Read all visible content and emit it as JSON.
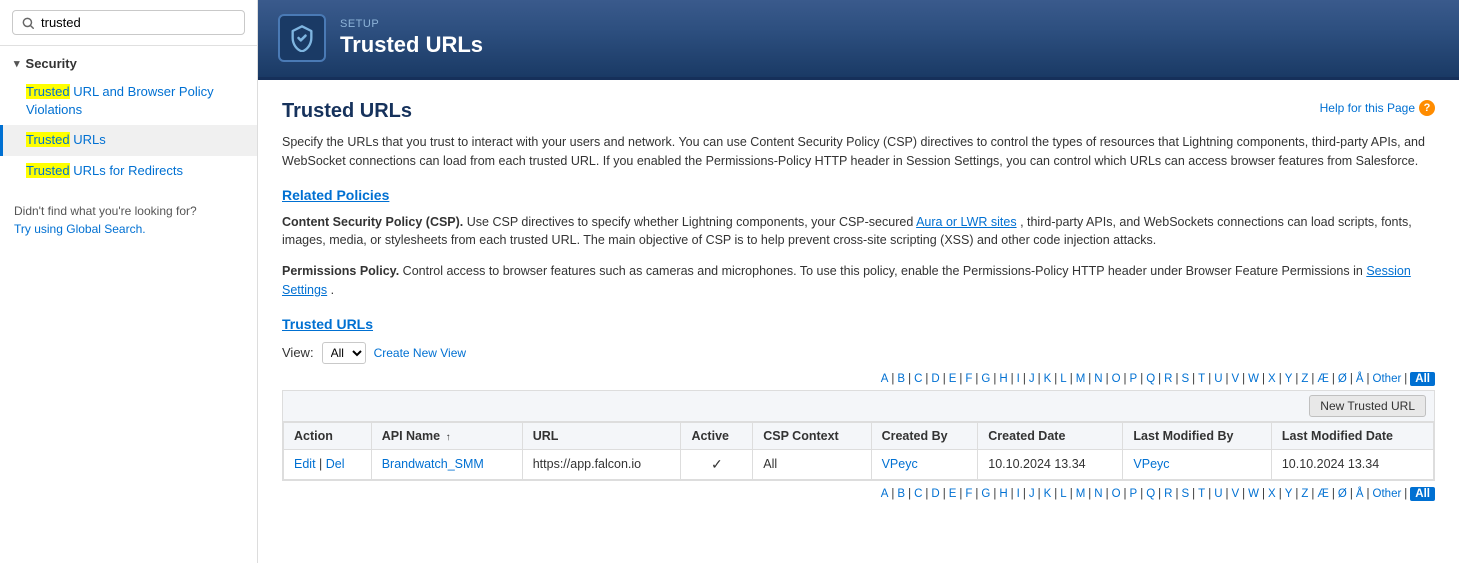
{
  "sidebar": {
    "search_placeholder": "trusted",
    "section_label": "Security",
    "items": [
      {
        "id": "trusted-url-browser",
        "label": "Trusted URL and Browser Policy Violations",
        "active": false,
        "highlight": "Trusted"
      },
      {
        "id": "trusted-urls",
        "label": "Trusted URLs",
        "active": true,
        "highlight": "Trusted"
      },
      {
        "id": "trusted-urls-redirects",
        "label": "Trusted URLs for Redirects",
        "active": false,
        "highlight": "Trusted"
      }
    ],
    "no_results_text": "Didn't find what you're looking for?",
    "no_results_link_text": "Try using Global Search."
  },
  "header": {
    "setup_label": "SETUP",
    "title": "Trusted URLs"
  },
  "page": {
    "title": "Trusted URLs",
    "help_link_text": "Help for this Page",
    "description": "Specify the URLs that you trust to interact with your users and network. You can use Content Security Policy (CSP) directives to control the types of resources that Lightning components, third-party APIs, and WebSocket connections can load from each trusted URL. If you enabled the Permissions-Policy HTTP header in Session Settings, you can control which URLs can access browser features from Salesforce.",
    "related_policies_heading": "Related Policies",
    "csp_label": "Content Security Policy (CSP).",
    "csp_text": "Use CSP directives to specify whether Lightning components, your CSP-secured",
    "csp_link_text": "Aura or LWR sites",
    "csp_text2": ", third-party APIs, and WebSockets connections can load scripts, fonts, images, media, or stylesheets from each trusted URL. The main objective of CSP is to help prevent cross-site scripting (XSS) and other code injection attacks.",
    "perm_label": "Permissions Policy.",
    "perm_text": "Control access to browser features such as cameras and microphones. To use this policy, enable the Permissions-Policy HTTP header under Browser Feature Permissions in",
    "perm_link_text": "Session Settings",
    "perm_text2": ".",
    "trusted_urls_heading": "Trusted URLs",
    "view_label": "View:",
    "view_option": "All",
    "create_new_view_link": "Create New View",
    "new_trusted_url_btn": "New Trusted URL",
    "alphabet": [
      "A",
      "B",
      "C",
      "D",
      "E",
      "F",
      "G",
      "H",
      "I",
      "J",
      "K",
      "L",
      "M",
      "N",
      "O",
      "P",
      "Q",
      "R",
      "S",
      "T",
      "U",
      "V",
      "W",
      "X",
      "Y",
      "Z",
      "Æ",
      "Ø",
      "Å",
      "Other",
      "All"
    ],
    "active_letter": "All",
    "table_headers": [
      "Action",
      "API Name ↑",
      "URL",
      "Active",
      "CSP Context",
      "Created By",
      "Created Date",
      "Last Modified By",
      "Last Modified Date"
    ],
    "table_rows": [
      {
        "edit_link": "Edit",
        "del_link": "Del",
        "api_name": "Brandwatch_SMM",
        "api_name_link": true,
        "url": "https://app.falcon.io",
        "active": true,
        "csp_context": "All",
        "created_by": "VPeyc",
        "created_date": "10.10.2024 13.34",
        "last_modified_by": "VPeyc",
        "last_modified_date": "10.10.2024 13.34"
      }
    ]
  }
}
